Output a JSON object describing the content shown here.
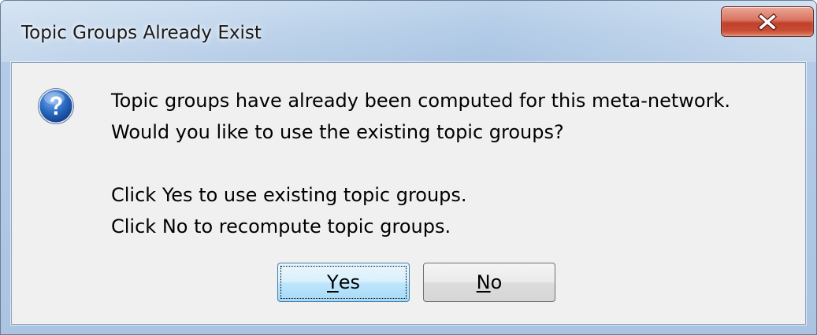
{
  "window": {
    "title": "Topic Groups Already Exist",
    "close_icon": "close-icon",
    "close_color": "#c74b33"
  },
  "dialog": {
    "icon": "question-icon",
    "message": {
      "line1": "Topic groups have already been computed for this meta-network.",
      "line2": "Would you like to use the existing topic groups?",
      "line3": "Click Yes to use existing topic groups.",
      "line4": "Click No to recompute topic groups."
    },
    "buttons": {
      "yes": {
        "mnemonic": "Y",
        "rest": "es"
      },
      "no": {
        "mnemonic": "N",
        "rest": "o"
      }
    }
  }
}
